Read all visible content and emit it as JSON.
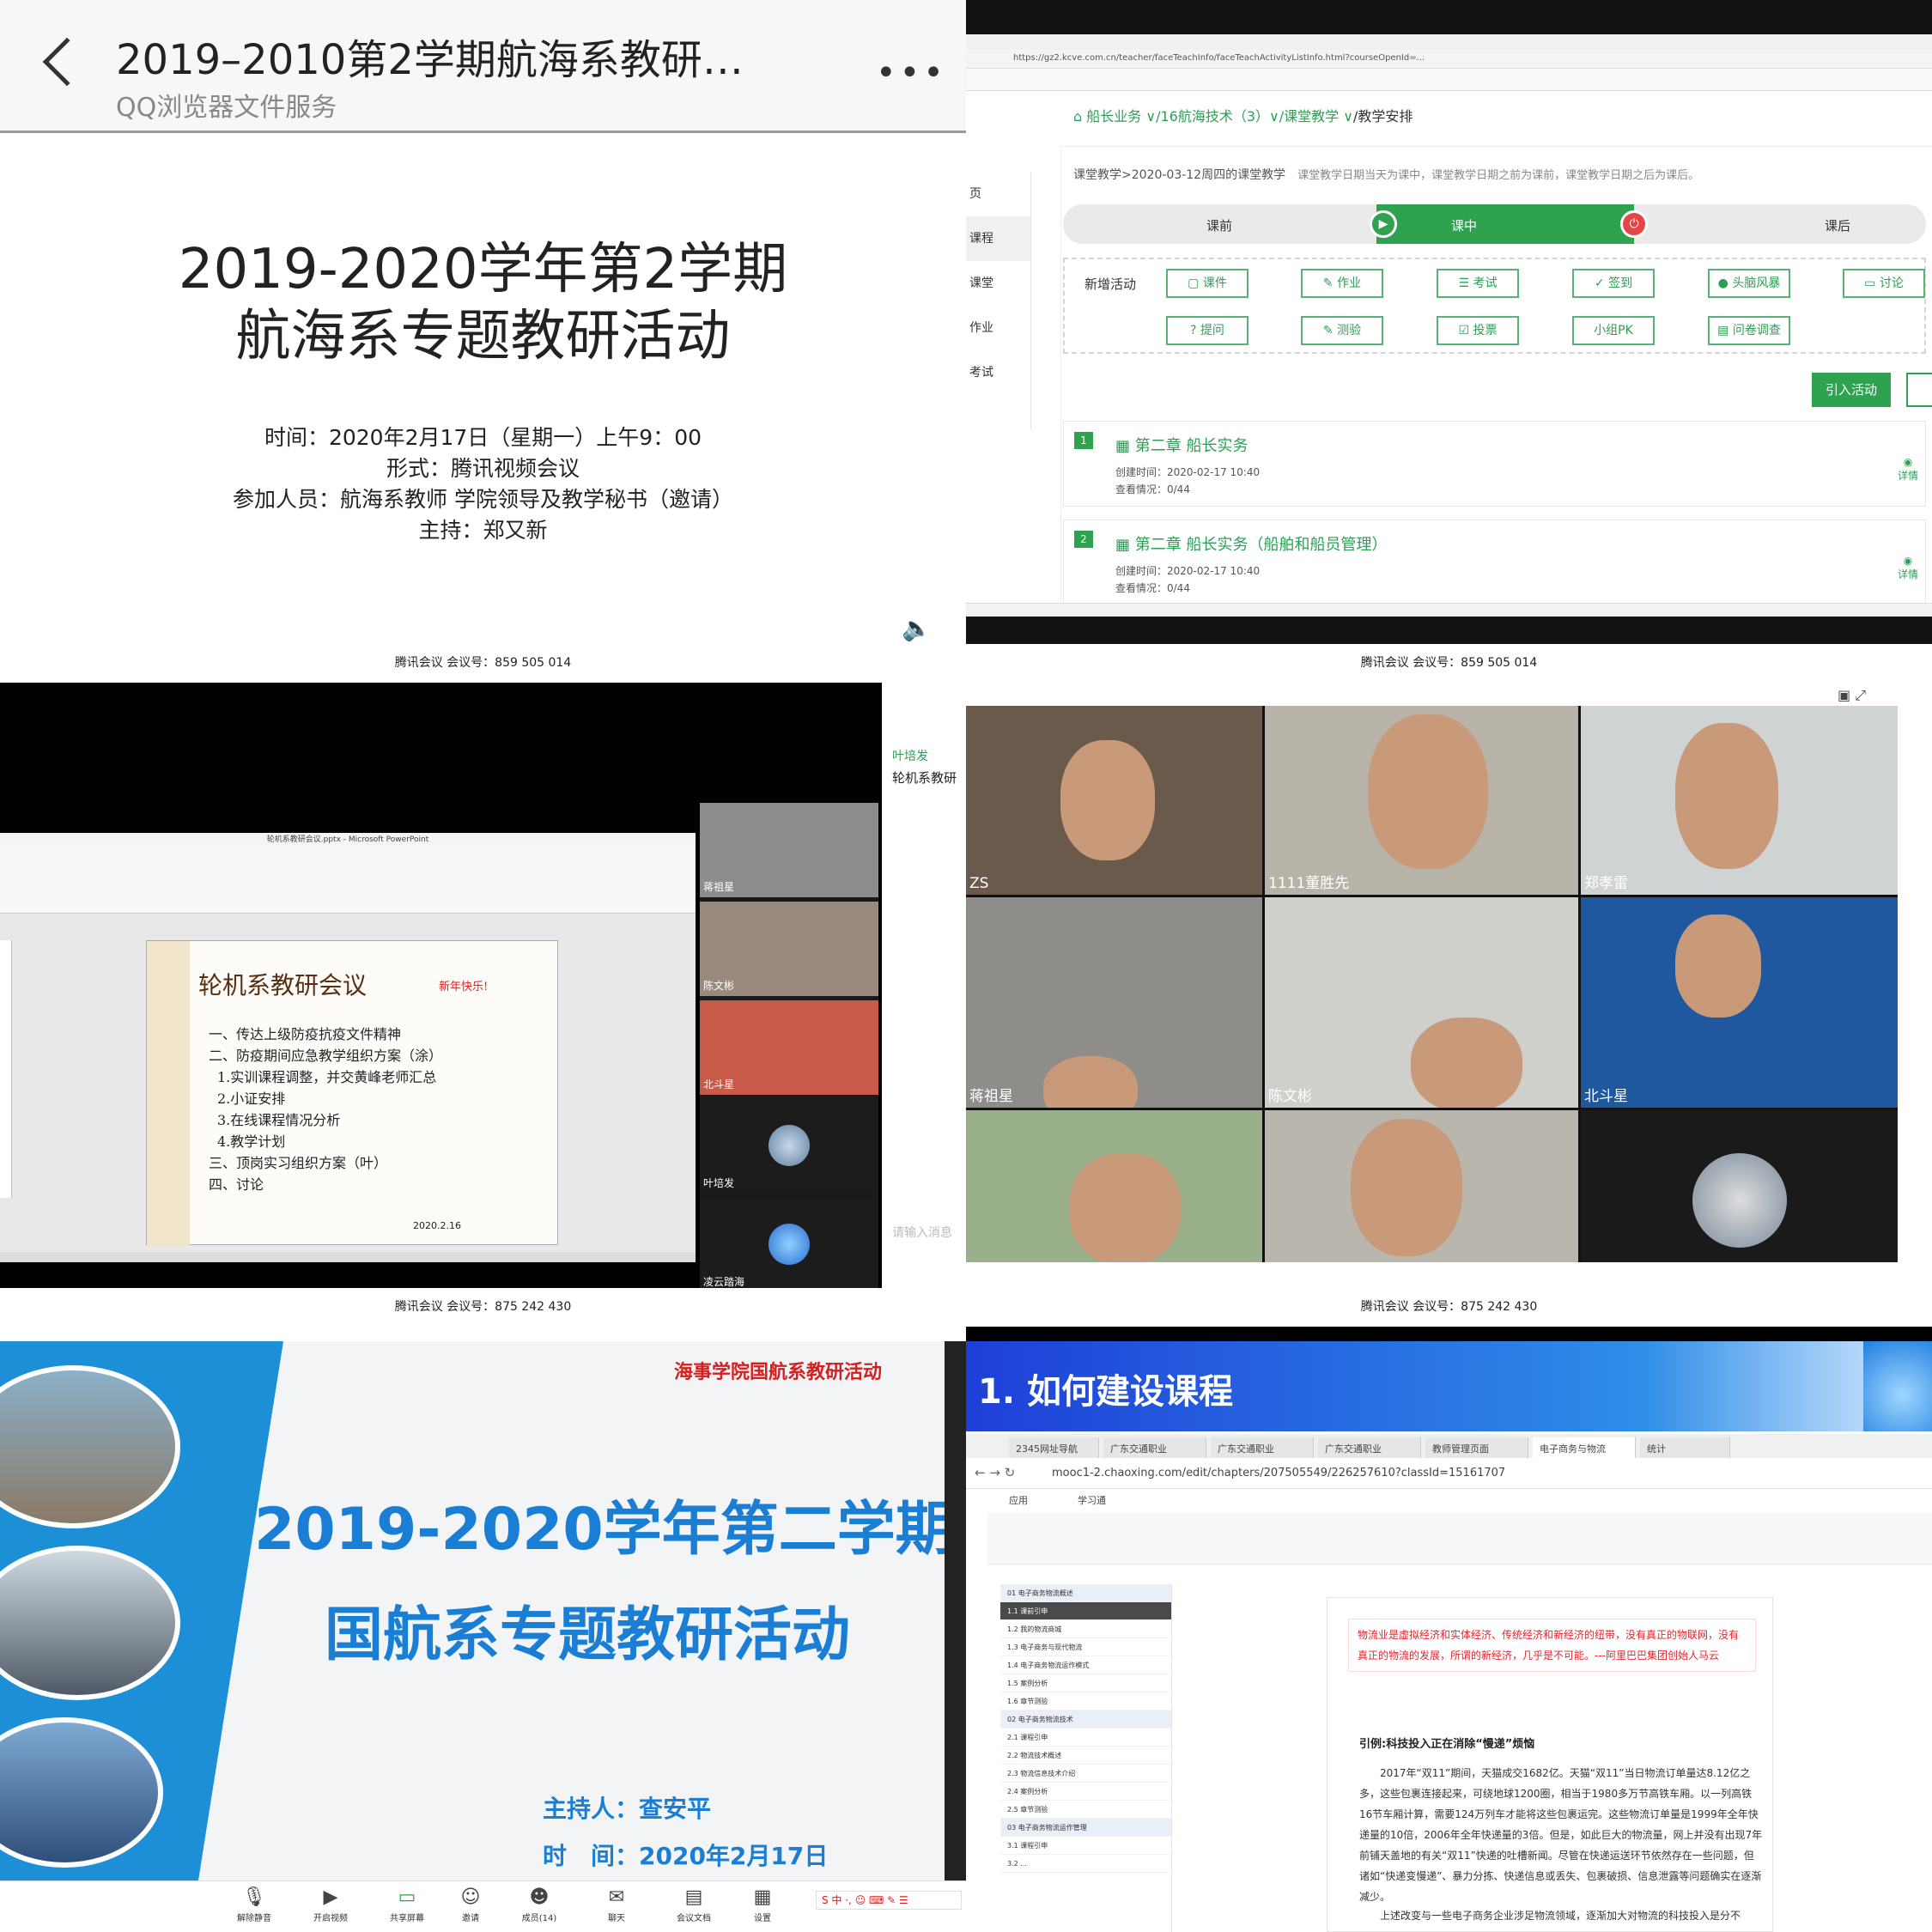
{
  "p1": {
    "header_title": "2019–2010第2学期航海系教研…",
    "header_subtitle": "QQ浏览器文件服务",
    "slide_title_line1": "2019-2020学年第2学期",
    "slide_title_line2": "航海系专题教研活动",
    "time": "时间：2020年2月17日（星期一）上午9：00",
    "form": "形式：腾讯视频会议",
    "participants": "参加人员：航海系教师 学院领导及教学秘书（邀请）",
    "host": "主持：郑又新"
  },
  "p2": {
    "url": "https://gz2.kcve.com.cn/teacher/faceTeachInfo/faceTeachActivityListInfo.html?courseOpenId=...",
    "breadcrumb": [
      "船长业务 ∨",
      "/16航海技术（3）∨",
      "/课堂教学 ∨",
      "/教学安排"
    ],
    "side_nav": [
      "页",
      "课程",
      "课堂",
      "作业",
      "考试"
    ],
    "notice": "课堂教学>2020-03-12周四的课堂教学",
    "notice_hint": "课堂教学日期当天为课中，课堂教学日期之前为课前，课堂教学日期之后为课后。",
    "steps": [
      "课前",
      "课中",
      "课后"
    ],
    "activity_label": "新增活动",
    "activities_row1": [
      "课件",
      "作业",
      "考试",
      "签到",
      "头脑风暴",
      "讨论"
    ],
    "activities_row2": [
      "提问",
      "测验",
      "投票",
      "小组PK",
      "问卷调查"
    ],
    "import_label": "引入活动",
    "items": [
      {
        "num": "1",
        "title": "第二章 船长实务",
        "created": "创建时间：2020-02-17 10:40",
        "views": "查看情况：0/44",
        "detail": "详情"
      },
      {
        "num": "2",
        "title": "第二章 船长实务（船舶和船员管理）",
        "created": "创建时间：2020-02-17 10:40",
        "views": "查看情况：0/44",
        "detail": "详情"
      }
    ]
  },
  "p3": {
    "meeting_header": "腾讯会议 会议号：859 505 014",
    "ppt_window_title": "轮机系教研会议.pptx - Microsoft PowerPoint",
    "slide_title": "轮机系教研会议",
    "slide_greeting": "新年快乐!",
    "slide_lines": [
      "一、传达上级防疫抗疫文件精神",
      "二、防疫期间应急教学组织方案（涂）",
      "1.实训课程调整，并交黄峰老师汇总",
      "2.小证安排",
      "3.在线课程情况分析",
      "4.教学计划",
      "三、顶岗实习组织方案（叶）",
      "四、讨论"
    ],
    "slide_date": "2020.2.16",
    "participants": [
      "蒋祖星",
      "陈文彬",
      "北斗星",
      "叶培发",
      "凌云踏海"
    ],
    "chat_name": "叶培发",
    "chat_message": "轮机系教研",
    "chat_placeholder": "请输入消息"
  },
  "p4": {
    "meeting_header": "腾讯会议 会议号：859 505 014",
    "participants": [
      "ZS",
      "1111董胜先",
      "郑孝雷",
      "蒋祖星",
      "陈文彬",
      "北斗星",
      "",
      "",
      ""
    ]
  },
  "p5": {
    "meeting_header": "腾讯会议 会议号：875 242 430",
    "red_title": "海事学院国航系教研活动",
    "title_line1": "2019-2020学年第二学期",
    "title_line2": "国航系专题教研活动",
    "host": "主持人：查安平",
    "date": "时　间：2020年2月17日",
    "toolbar": [
      "解除静音",
      "开启视频",
      "共享屏幕",
      "邀请",
      "成员(14)",
      "聊天",
      "会议文档",
      "设置"
    ]
  },
  "p6": {
    "meeting_header": "腾讯会议 会议号：875 242 430",
    "banner_title": "1. 如何建设课程",
    "tabs": [
      "2345网址导航",
      "广东交通职业",
      "广东交通职业",
      "广东交通职业",
      "教师管理页面",
      "电子商务与物流",
      "统计"
    ],
    "url": "mooc1-2.chaoxing.com/edit/chapters/207505549/226257610?classId=15161707",
    "app_items": [
      "应用",
      "学习通"
    ],
    "quote": "物流业是虚拟经济和实体经济、传统经济和新经济的纽带，没有真正的物联网，没有真正的物流的发展，所谓的新经济，几乎是不可能。---阿里巴巴集团创始人马云",
    "subheading": "引例:科技投入正在消除“慢递”烦恼",
    "paragraph": "2017年“双11”期间，天猫成交1682亿。天猫“双11”当日物流订单量达8.12亿之多，这些包裹连接起来，可绕地球1200圈，相当于1980多万节高铁车厢。以一列高铁16节车厢计算，需要124万列车才能将这些包裹运完。这些物流订单量是1999年全年快递量的10倍，2006年全年快递量的3倍。但是，如此巨大的物流量，网上并没有出现7年前铺天盖地的有关“双11”快递的吐槽新闻。尽管在快递运送环节依然存在一些问题，但诸如“快递变慢递”、暴力分拣、快递信息或丢失、包裹破损、信息泄露等问题确实在逐渐减少。",
    "paragraph2": "上述改变与一些电子商务企业涉足物流领域，逐渐加大对物流的科技投入是分不",
    "chapters": [
      "01 电子商务物流概述",
      "1.1 课前引申",
      "1.2 我的物流商城",
      "1.3 电子商务与现代物流",
      "1.4 电子商务物流运作模式",
      "1.5 案例分析",
      "1.6 章节测验",
      "02 电子商务物流技术",
      "2.1 课程引申",
      "2.2 物流技术概述",
      "2.3 物流信息技术介绍",
      "2.4 案例分析",
      "2.5 章节测验",
      "03 电子商务物流运作管理",
      "3.1 课程引申",
      "3.2 ..."
    ]
  }
}
